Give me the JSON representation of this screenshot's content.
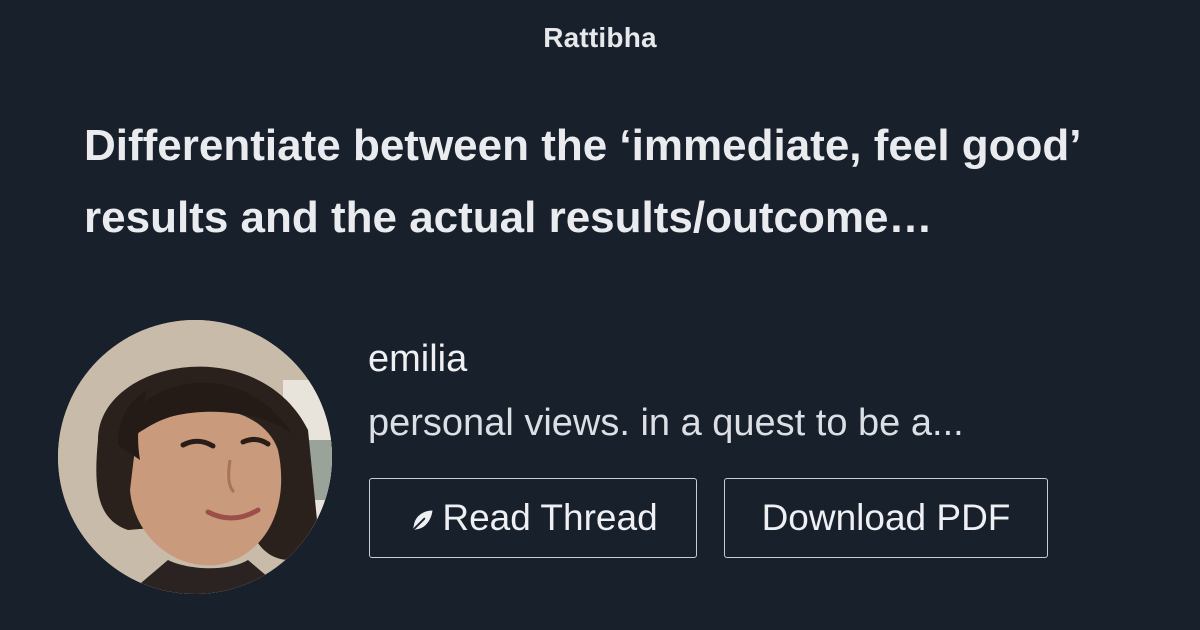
{
  "brand": "Rattibha",
  "thread": {
    "title": "Differentiate between the ‘immediate, feel good’ results and the actual results/outcome…"
  },
  "author": {
    "name": "emilia",
    "bio": "personal views. in a quest to be a...",
    "avatar_icon": "person-photo"
  },
  "actions": {
    "read_thread": {
      "label": "Read Thread",
      "icon": "feather-icon"
    },
    "download_pdf": {
      "label": "Download PDF"
    }
  },
  "colors": {
    "background": "#18202b",
    "text": "#eef0f3",
    "button_border": "#c9cdd3"
  }
}
